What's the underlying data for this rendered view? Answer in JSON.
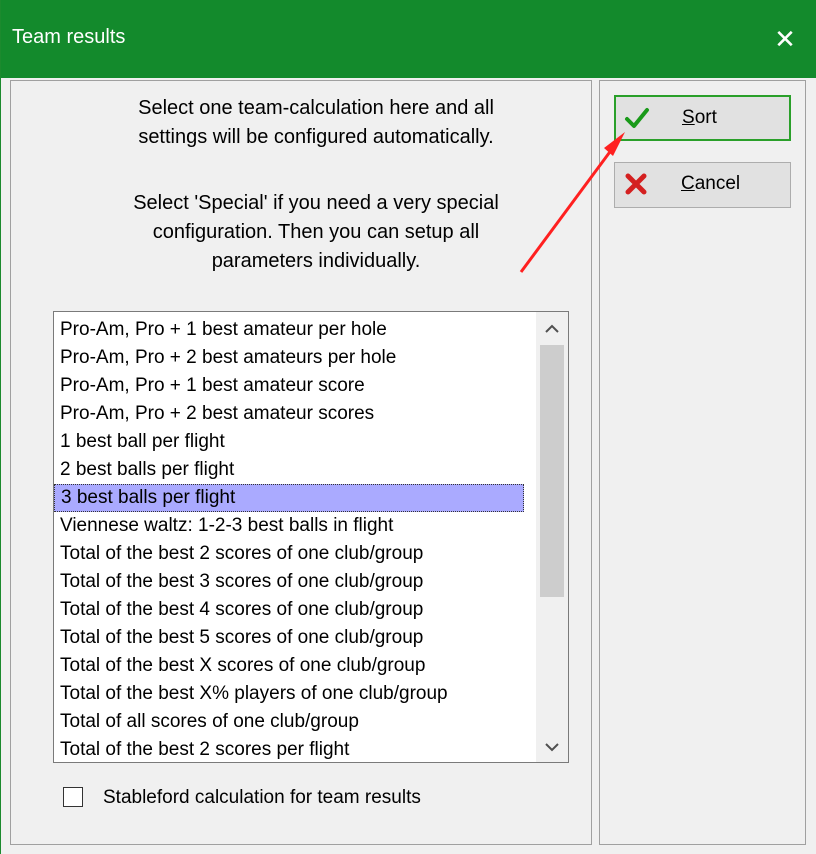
{
  "window": {
    "title": "Team results",
    "close_glyph": "✕"
  },
  "description": {
    "line1a": "Select one team-calculation here and all",
    "line1b": "settings will be configured automatically.",
    "line2a": "Select 'Special' if you need a very special",
    "line2b": "configuration. Then you can setup all",
    "line2c": "parameters individually."
  },
  "list": {
    "items": [
      "Pro-Am, Pro + 1 best amateur per hole",
      "Pro-Am, Pro + 2 best amateurs per hole",
      "Pro-Am, Pro + 1 best amateur score",
      "Pro-Am, Pro + 2 best amateur scores",
      "1 best ball per flight",
      "2 best balls per flight",
      "3 best balls per flight",
      "Viennese waltz: 1-2-3 best balls in flight",
      "Total of the best 2 scores of one club/group",
      "Total of the best 3 scores of one club/group",
      "Total of the best 4 scores of one club/group",
      "Total of the best 5 scores of one club/group",
      "Total of the best X scores of one club/group",
      "Total of the best X% players of one club/group",
      "Total of all scores of one club/group",
      "Total of the best 2 scores per flight"
    ],
    "selected_index": 6,
    "scroll_up_icon": "chevron-up-icon",
    "scroll_down_icon": "chevron-down-icon"
  },
  "checkbox": {
    "label": "Stableford calculation for team results",
    "checked": false
  },
  "buttons": {
    "sort": {
      "label": "Sort",
      "icon": "checkmark-icon",
      "icon_color": "#1a9a1a"
    },
    "cancel": {
      "label": "Cancel",
      "icon": "red-x-icon",
      "icon_color": "#d42020"
    }
  },
  "annotation": {
    "arrow_color": "#ff2020"
  },
  "colors": {
    "titlebar": "#138a2c",
    "selection": "#aaaaff"
  }
}
